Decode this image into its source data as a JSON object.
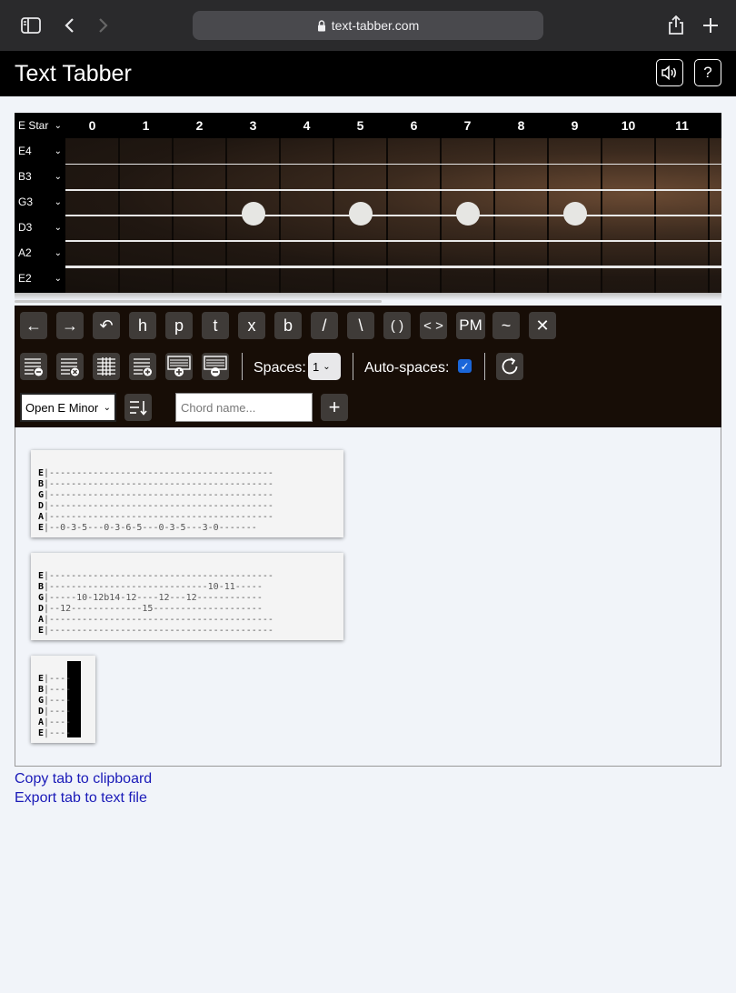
{
  "browser": {
    "url": "text-tabber.com"
  },
  "app": {
    "title": "Text Tabber"
  },
  "fretboard": {
    "tuning_label": "E Star",
    "fret_numbers": [
      "0",
      "1",
      "2",
      "3",
      "4",
      "5",
      "6",
      "7",
      "8",
      "9",
      "10",
      "11"
    ],
    "strings": [
      "E4",
      "B3",
      "G3",
      "D3",
      "A2",
      "E2"
    ],
    "marker_frets": [
      3,
      5,
      7,
      9
    ]
  },
  "toolbar": {
    "row1": [
      {
        "name": "arrow-left-button",
        "label": "←"
      },
      {
        "name": "arrow-right-button",
        "label": "→"
      },
      {
        "name": "undo-button",
        "label": "↶"
      },
      {
        "name": "hammer-on-button",
        "label": "h"
      },
      {
        "name": "pull-off-button",
        "label": "p"
      },
      {
        "name": "tap-button",
        "label": "t"
      },
      {
        "name": "mute-button",
        "label": "x"
      },
      {
        "name": "bend-button",
        "label": "b"
      },
      {
        "name": "slide-up-button",
        "label": "/"
      },
      {
        "name": "slide-down-button",
        "label": "\\"
      },
      {
        "name": "ghost-note-button",
        "label": "( )"
      },
      {
        "name": "harmonic-button",
        "label": "< >"
      },
      {
        "name": "palm-mute-button",
        "label": "PM"
      },
      {
        "name": "vibrato-button",
        "label": "~"
      },
      {
        "name": "clear-button",
        "label": "✕"
      }
    ],
    "spaces_label": "Spaces:",
    "spaces_value": "1",
    "auto_spaces_label": "Auto-spaces:",
    "chord_preset": "Open E Minor",
    "chord_name_placeholder": "Chord name...",
    "add_chord_label": "+"
  },
  "tabs": [
    {
      "rows": [
        {
          "s": "E",
          "t": "|-----------------------------------------"
        },
        {
          "s": "B",
          "t": "|-----------------------------------------"
        },
        {
          "s": "G",
          "t": "|-----------------------------------------"
        },
        {
          "s": "D",
          "t": "|-----------------------------------------"
        },
        {
          "s": "A",
          "t": "|-----------------------------------------"
        },
        {
          "s": "E",
          "t": "|--0-3-5---0-3-6-5---0-3-5---3-0-------"
        }
      ]
    },
    {
      "rows": [
        {
          "s": "E",
          "t": "|-----------------------------------------"
        },
        {
          "s": "B",
          "t": "|-----------------------------10-11-----"
        },
        {
          "s": "G",
          "t": "|-----10-12b14-12----12---12------------"
        },
        {
          "s": "D",
          "t": "|--12-------------15--------------------"
        },
        {
          "s": "A",
          "t": "|-----------------------------------------"
        },
        {
          "s": "E",
          "t": "|-----------------------------------------"
        }
      ]
    },
    {
      "rows": [
        {
          "s": "E",
          "t": "|----"
        },
        {
          "s": "B",
          "t": "|----"
        },
        {
          "s": "G",
          "t": "|----"
        },
        {
          "s": "D",
          "t": "|----"
        },
        {
          "s": "A",
          "t": "|----"
        },
        {
          "s": "E",
          "t": "|----"
        }
      ]
    }
  ],
  "links": {
    "copy": "Copy tab to clipboard",
    "export": "Export tab to text file"
  }
}
